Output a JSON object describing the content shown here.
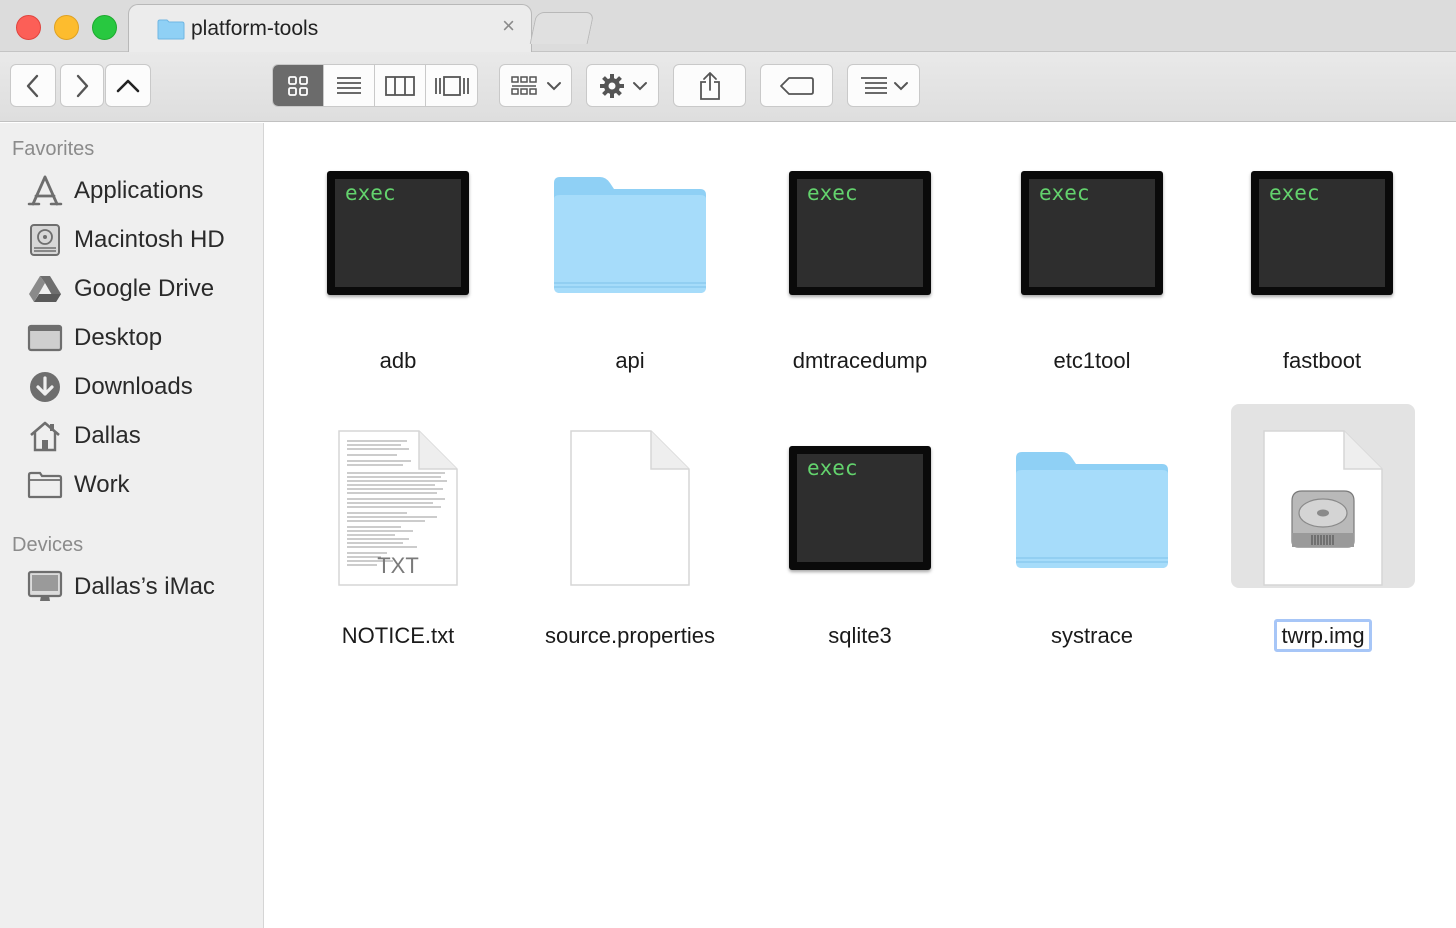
{
  "window": {
    "tab_title": "platform-tools",
    "tab_close": "×"
  },
  "toolbar": {
    "back_icon": "chevron-left-icon",
    "forward_icon": "chevron-right-icon",
    "up_icon": "chevron-up-icon",
    "view_modes": [
      "icon",
      "list",
      "column",
      "cover-flow"
    ],
    "active_view": "icon",
    "arrange_icon": "grid-arrange-icon",
    "action_icon": "gear-icon",
    "share_icon": "share-icon",
    "tags_icon": "tag-icon",
    "sort_icon": "sort-list-icon"
  },
  "sidebar": {
    "favorites_heading": "Favorites",
    "favorites": [
      {
        "label": "Applications",
        "icon": "applications-icon"
      },
      {
        "label": "Macintosh HD",
        "icon": "hard-drive-icon"
      },
      {
        "label": "Google Drive",
        "icon": "google-drive-icon"
      },
      {
        "label": "Desktop",
        "icon": "desktop-icon"
      },
      {
        "label": "Downloads",
        "icon": "downloads-icon"
      },
      {
        "label": "Dallas",
        "icon": "home-icon"
      },
      {
        "label": "Work",
        "icon": "folder-icon"
      }
    ],
    "devices_heading": "Devices",
    "devices": [
      {
        "label": "Dallas’s iMac",
        "icon": "imac-icon"
      }
    ]
  },
  "files": [
    {
      "name": "adb",
      "type": "exec",
      "badge": "exec"
    },
    {
      "name": "api",
      "type": "folder"
    },
    {
      "name": "dmtracedump",
      "type": "exec",
      "badge": "exec"
    },
    {
      "name": "etc1tool",
      "type": "exec",
      "badge": "exec"
    },
    {
      "name": "fastboot",
      "type": "exec",
      "badge": "exec"
    },
    {
      "name": "NOTICE.txt",
      "type": "text",
      "badge": "TXT"
    },
    {
      "name": "source.properties",
      "type": "document"
    },
    {
      "name": "sqlite3",
      "type": "exec",
      "badge": "exec"
    },
    {
      "name": "systrace",
      "type": "folder"
    },
    {
      "name": "twrp.img",
      "type": "disk-image",
      "selected": true
    }
  ],
  "colors": {
    "exec_text": "#63d36d",
    "folder": "#8fd0f5",
    "selection_ring": "#a7c6f7"
  }
}
